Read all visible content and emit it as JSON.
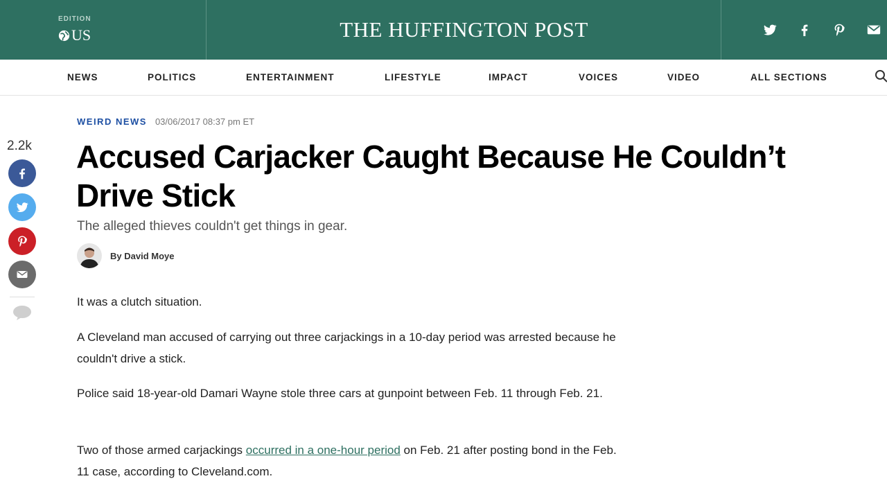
{
  "header": {
    "edition_label": "EDITION",
    "edition_value": "US",
    "brand": "THE HUFFINGTON POST",
    "social": [
      "twitter-icon",
      "facebook-icon",
      "pinterest-icon",
      "email-icon"
    ]
  },
  "nav": {
    "items": [
      {
        "label": "NEWS"
      },
      {
        "label": "POLITICS"
      },
      {
        "label": "ENTERTAINMENT"
      },
      {
        "label": "LIFESTYLE"
      },
      {
        "label": "IMPACT"
      },
      {
        "label": "VOICES"
      },
      {
        "label": "VIDEO"
      },
      {
        "label": "ALL SECTIONS"
      }
    ]
  },
  "share": {
    "count": "2.2k"
  },
  "article": {
    "section": "WEIRD NEWS",
    "timestamp": "03/06/2017 08:37 pm ET",
    "headline": "Accused Carjacker Caught Because He Couldn’t Drive Stick",
    "dek": "The alleged thieves couldn't get things in gear.",
    "byline": "By David Moye",
    "paragraphs": [
      "It was a clutch situation.",
      "A Cleveland man accused of carrying out three carjackings in a 10-day period was arrested because he couldn't drive a stick.",
      "Police said 18-year-old Damari Wayne stole three cars at gunpoint between Feb. 11 through Feb. 21."
    ],
    "p4": {
      "before": "Two of those armed carjackings ",
      "link": "occurred in a one-hour period",
      "after": " on Feb. 21 after posting bond in the Feb. 11 case, according to Cleveland.com."
    }
  },
  "colors": {
    "brand_green": "#2e7061",
    "section_blue": "#1d4fa3",
    "facebook": "#3b5998",
    "twitter": "#55acee",
    "pinterest": "#cb2027"
  }
}
